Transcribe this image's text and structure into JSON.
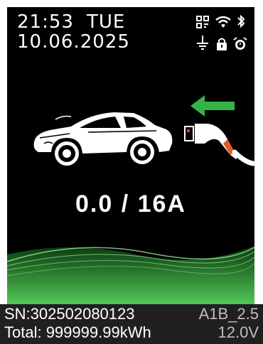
{
  "status_bar": {
    "time": "21:53",
    "day": "TUE",
    "date": "10.06.2025",
    "icons": [
      "qr-icon",
      "wifi-icon",
      "bluetooth-icon",
      "ground-icon",
      "lock-icon",
      "alarm-icon"
    ]
  },
  "charging": {
    "current_display": "0.0 / 16A",
    "arrow_color": "#35b34a"
  },
  "footer": {
    "serial": "SN:302502080123",
    "version": "A1B_2.5",
    "total_energy": "Total: 999999.99kWh",
    "voltage": "12.0V"
  }
}
